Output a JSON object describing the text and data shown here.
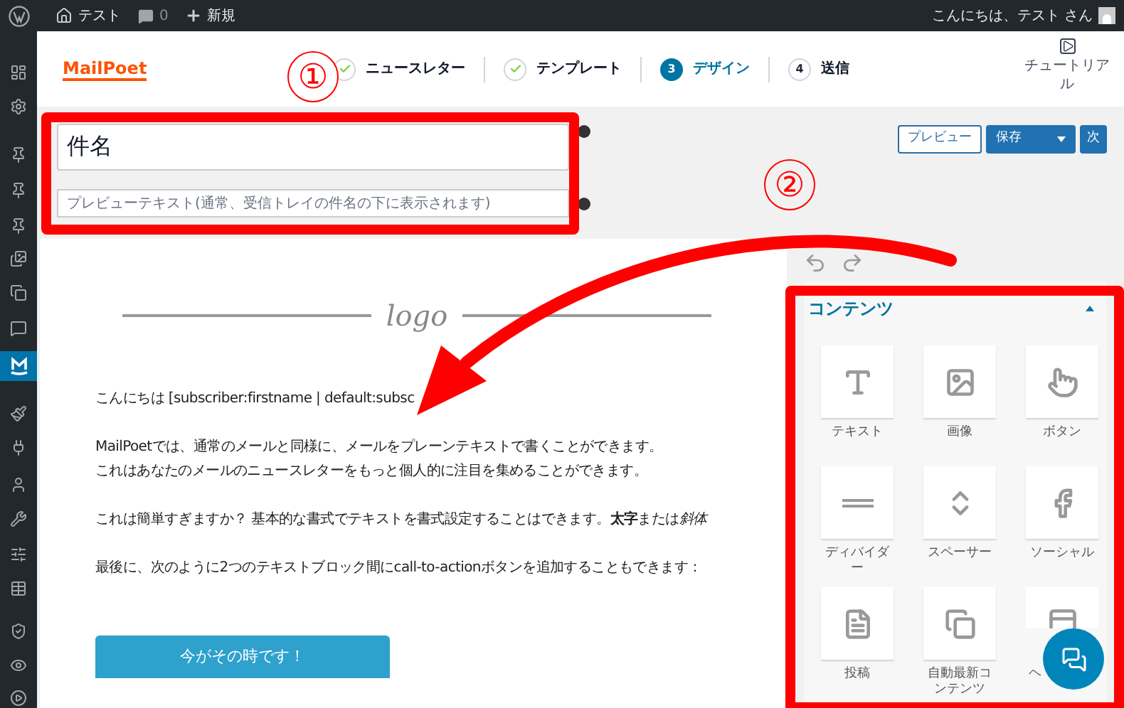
{
  "admin_bar": {
    "site": "テスト",
    "comments": "0",
    "new": "新規",
    "greeting": "こんにちは、テスト さん"
  },
  "sidebar": {
    "items": [
      {
        "selected": false
      },
      {
        "selected": false
      },
      {
        "selected": false
      },
      {
        "selected": false
      },
      {
        "selected": false
      },
      {
        "selected": false
      },
      {
        "selected": false
      },
      {
        "selected": false
      },
      {
        "selected": true
      },
      {
        "selected": false
      },
      {
        "selected": false
      },
      {
        "selected": false
      },
      {
        "selected": false
      },
      {
        "selected": false
      },
      {
        "selected": false
      },
      {
        "selected": false
      },
      {
        "selected": false
      },
      {
        "selected": false
      }
    ]
  },
  "header": {
    "logo": "MailPoet",
    "steps": [
      {
        "label": "ニュースレター",
        "done": true,
        "selected": false
      },
      {
        "label": "テンプレート",
        "done": true,
        "selected": false
      },
      {
        "number": "3",
        "label": "デザイン",
        "done": false,
        "selected": true
      },
      {
        "number": "4",
        "label": "送信",
        "done": false,
        "selected": false
      }
    ],
    "tutorial": "チュートリアル"
  },
  "subject": {
    "value": "件名"
  },
  "preview_text": {
    "placeholder": "プレビューテキスト(通常、受信トレイの件名の下に表示されます)"
  },
  "buttons": {
    "preview": "プレビュー",
    "save": "保存",
    "next": "次"
  },
  "email": {
    "logo": "logo",
    "paragraphs": [
      {
        "runs": [
          {
            "text": "こんにちは [subscriber:firstname | default:subsc"
          }
        ]
      },
      {
        "runs": [
          {
            "text": "MailPoetでは、通常のメールと同様に、メールをプレーンテキストで書くことができます。"
          },
          {
            "text": "これはあなたのメールのニュースレターをもっと個人的に注目を集めることができます。",
            "break": true
          }
        ]
      },
      {
        "runs": [
          {
            "text": "これは簡単すぎますか？ 基本的な書式でテキストを書式設定することはできます。"
          },
          {
            "text": "太字",
            "bold": true
          },
          {
            "text": "または"
          },
          {
            "text": "斜体",
            "italic": true
          }
        ]
      },
      {
        "runs": [
          {
            "text": "最後に、次のように2つのテキストブロック間にcall-to-actionボタンを追加することもできます："
          }
        ]
      }
    ],
    "cta": "今がその時です！"
  },
  "panel": {
    "title": "コンテンツ",
    "expanded": true,
    "blocks": [
      {
        "label": "テキスト"
      },
      {
        "label": "画像"
      },
      {
        "label": "ボタン"
      },
      {
        "label": "ディバイダー"
      },
      {
        "label": "スペーサー"
      },
      {
        "label": "ソーシャル"
      },
      {
        "label": "投稿"
      },
      {
        "label": "自動最新コンテンツ"
      },
      {
        "label": "ヘ"
      }
    ]
  },
  "annotations": {
    "markers": [
      "①",
      "②"
    ]
  }
}
